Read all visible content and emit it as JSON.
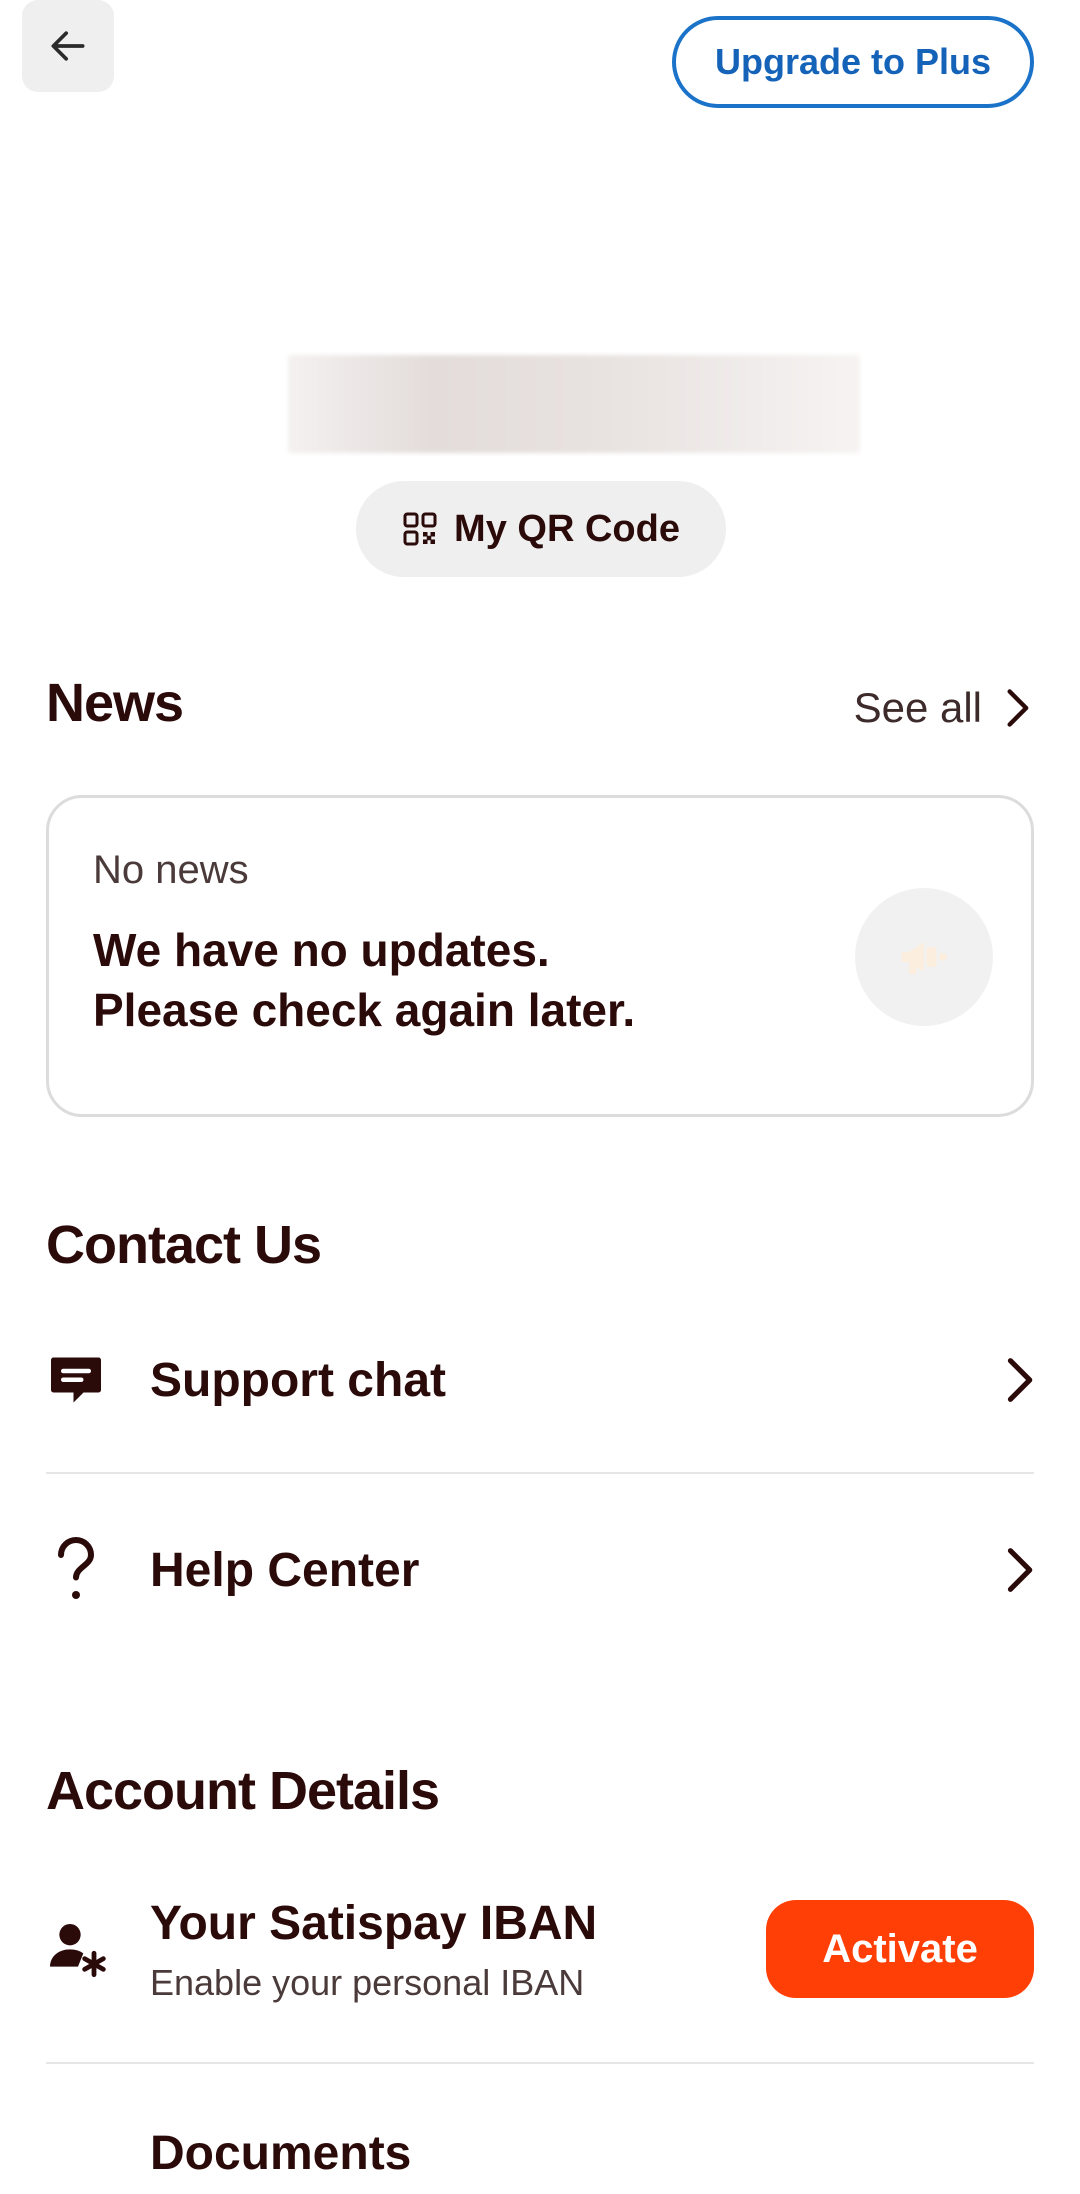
{
  "header": {
    "back_icon": "arrow-left-icon",
    "upgrade_label": "Upgrade to Plus"
  },
  "profile": {
    "qr_label": "My QR Code",
    "qr_icon": "qr-code-icon"
  },
  "news": {
    "title": "News",
    "see_all_label": "See all",
    "card": {
      "kicker": "No news",
      "line1": "We have no updates.",
      "line2": "Please check again later.",
      "icon": "megaphone-icon"
    }
  },
  "contact": {
    "title": "Contact Us",
    "items": [
      {
        "label": "Support chat",
        "icon": "chat-icon"
      },
      {
        "label": "Help Center",
        "icon": "question-icon"
      }
    ]
  },
  "account": {
    "title": "Account Details",
    "iban": {
      "title": "Your Satispay IBAN",
      "subtitle": "Enable your personal IBAN",
      "action_label": "Activate",
      "icon": "user-asterisk-icon"
    },
    "documents_label": "Documents"
  },
  "colors": {
    "text": "#2b0a0a",
    "accent_blue": "#1463b8",
    "accent_orange": "#ff3f05",
    "surface": "#efefef"
  }
}
